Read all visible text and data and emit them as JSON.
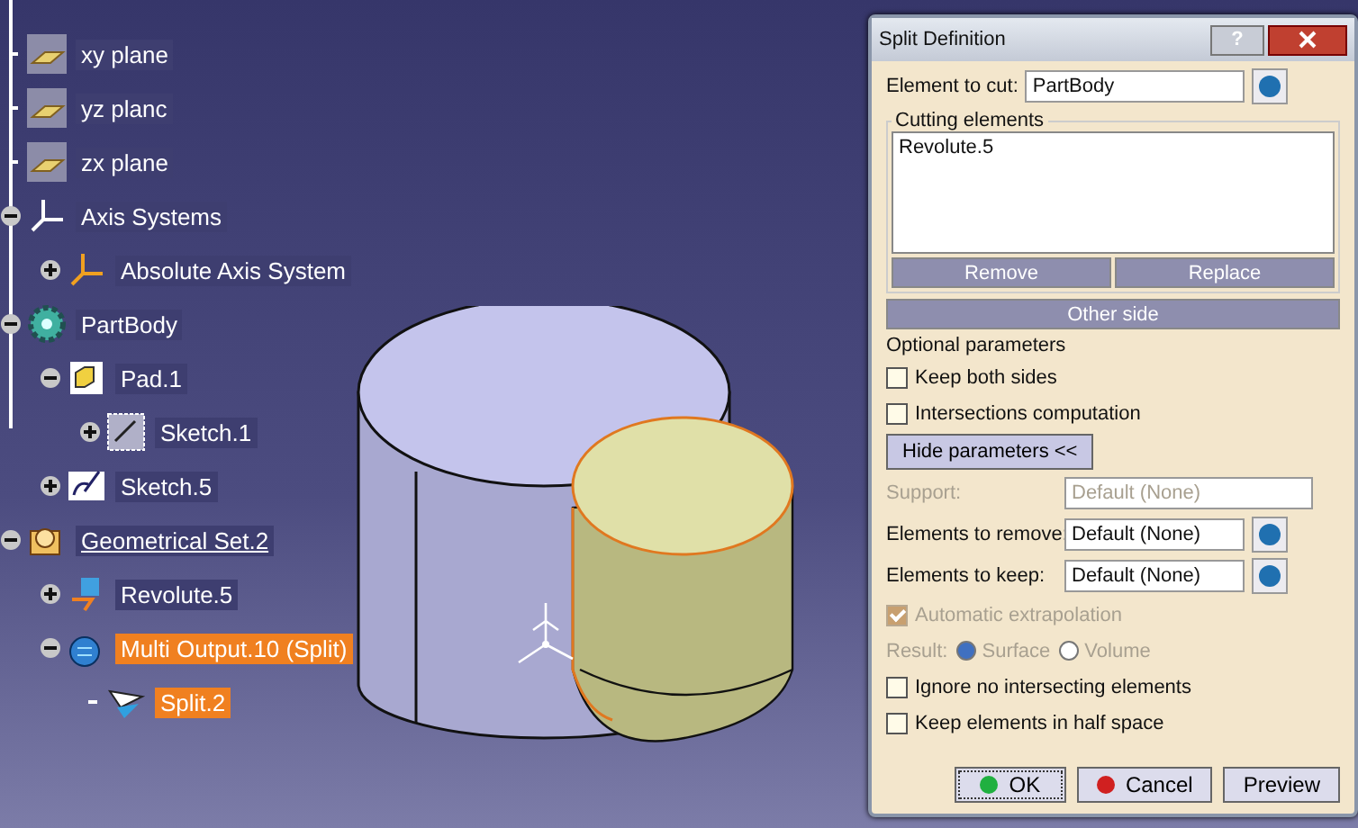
{
  "tree": [
    {
      "label": "xy plane",
      "kind": "plane"
    },
    {
      "label": "yz planc",
      "kind": "plane"
    },
    {
      "label": "zx plane",
      "kind": "plane"
    },
    {
      "label": "Axis Systems",
      "kind": "axis",
      "expanded": true,
      "children": [
        {
          "label": "Absolute Axis System",
          "kind": "axis-abs",
          "expanded": false
        }
      ]
    },
    {
      "label": "PartBody",
      "kind": "body",
      "expanded": true,
      "children": [
        {
          "label": "Pad.1",
          "kind": "pad",
          "expanded": true,
          "children": [
            {
              "label": "Sketch.1",
              "kind": "sketch-grid",
              "expanded": false
            }
          ]
        },
        {
          "label": "Sketch.5",
          "kind": "sketch",
          "expanded": false
        }
      ]
    },
    {
      "label": "Geometrical Set.2",
      "kind": "set",
      "expanded": true,
      "current": true,
      "children": [
        {
          "label": "Revolute.5",
          "kind": "revolute",
          "expanded": false
        },
        {
          "label": "Multi Output.10 (Split)",
          "kind": "multi",
          "expanded": true,
          "selected": true,
          "children": [
            {
              "label": "Split.2",
              "kind": "split",
              "selected": true
            }
          ]
        }
      ]
    }
  ],
  "dialog": {
    "title": "Split Definition",
    "help": "?",
    "element_to_cut": {
      "label": "Element to cut:",
      "value": "PartBody"
    },
    "cutting_elements": {
      "legend": "Cutting elements",
      "items": [
        "Revolute.5"
      ],
      "buttons": [
        {
          "label": "Remove",
          "disabled": true
        },
        {
          "label": "Replace",
          "disabled": true
        }
      ],
      "other_side": {
        "label": "Other side",
        "disabled": true
      }
    },
    "optional_label": "Optional parameters",
    "options_top": [
      {
        "label": "Keep both sides",
        "checked": false
      },
      {
        "label": "Intersections computation",
        "checked": false
      }
    ],
    "hide_button": "Hide parameters <<",
    "fields": [
      {
        "label": "Support:",
        "value": "Default (None)",
        "disabled": true,
        "picker": false
      },
      {
        "label": "Elements to remove:",
        "value": "Default (None)",
        "disabled": false,
        "picker": true
      },
      {
        "label": "Elements to keep:",
        "value": "Default (None)",
        "disabled": false,
        "picker": true
      }
    ],
    "extrapolation": {
      "label": "Automatic extrapolation",
      "checked": true,
      "disabled": true
    },
    "result": {
      "label": "Result:",
      "disabled": true,
      "options": [
        {
          "label": "Surface",
          "selected": true
        },
        {
          "label": "Volume",
          "selected": false
        }
      ]
    },
    "options_bottom": [
      {
        "label": "Ignore no intersecting elements",
        "checked": false
      },
      {
        "label": "Keep elements in half space",
        "checked": false
      }
    ],
    "buttons": [
      {
        "label": "OK",
        "kind": "ok"
      },
      {
        "label": "Cancel",
        "kind": "cancel"
      },
      {
        "label": "Preview",
        "kind": "plain"
      }
    ]
  }
}
